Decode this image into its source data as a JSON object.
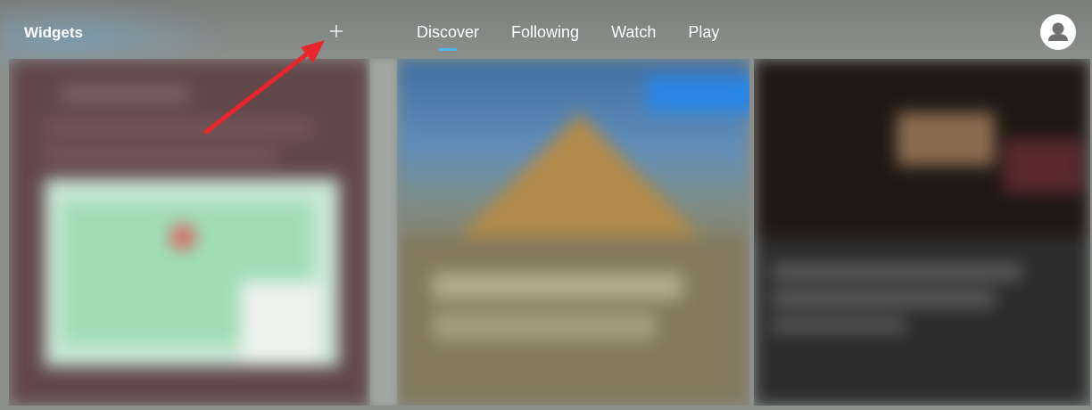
{
  "header": {
    "title": "Widgets",
    "add_icon": "plus-icon",
    "tabs": [
      {
        "label": "Discover",
        "active": true
      },
      {
        "label": "Following",
        "active": false
      },
      {
        "label": "Watch",
        "active": false
      },
      {
        "label": "Play",
        "active": false
      }
    ],
    "profile_icon": "user-avatar-icon"
  },
  "colors": {
    "active_tab_indicator": "#4db8f0",
    "annotation_arrow": "#e8262b"
  },
  "feed": {
    "cards": [
      {
        "icon": "map-thumbnail"
      },
      {
        "icon": "landscape-thumbnail"
      },
      {
        "icon": "news-thumbnail"
      }
    ]
  }
}
